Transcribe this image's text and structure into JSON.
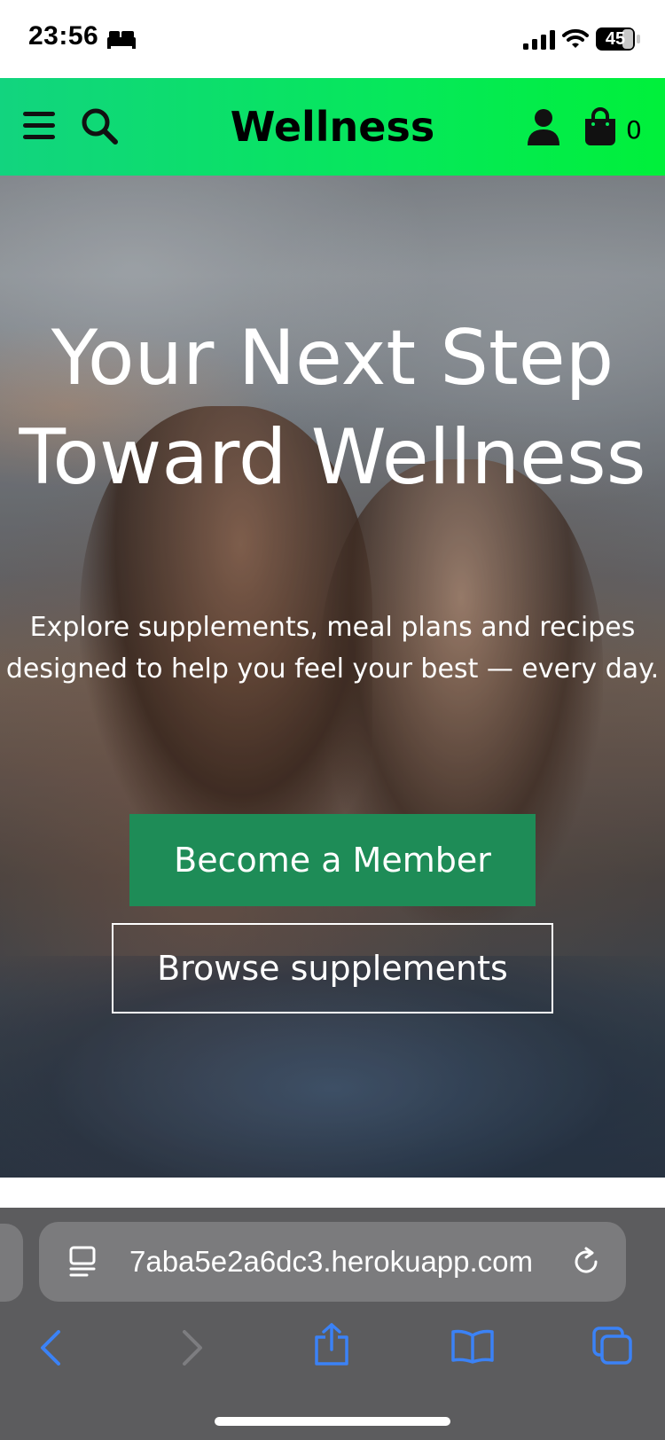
{
  "status_bar": {
    "time": "23:56",
    "battery": "45"
  },
  "header": {
    "site_title": "Wellness",
    "cart_count": "0"
  },
  "hero": {
    "heading": "Your Next Step Toward Wellness",
    "subtext": "Explore supplements, meal plans and recipes designed to help you feel your best — every day.",
    "primary_button": "Become a Member",
    "secondary_button": "Browse supplements"
  },
  "browser": {
    "url": "7aba5e2a6dc3.herokuapp.com"
  },
  "colors": {
    "header_gradient_start": "#12d47f",
    "header_gradient_end": "#00f03a",
    "primary_button": "#1e8c57",
    "browser_chrome": "#5c5c5e",
    "toolbar_icon": "#3b82f6"
  },
  "icons": [
    "sleep-icon",
    "signal-icon",
    "wifi-icon",
    "battery-icon",
    "menu-icon",
    "search-icon",
    "account-icon",
    "cart-icon",
    "page-menu-icon",
    "reload-icon",
    "back-icon",
    "forward-icon",
    "share-icon",
    "bookmarks-icon",
    "tabs-icon"
  ]
}
